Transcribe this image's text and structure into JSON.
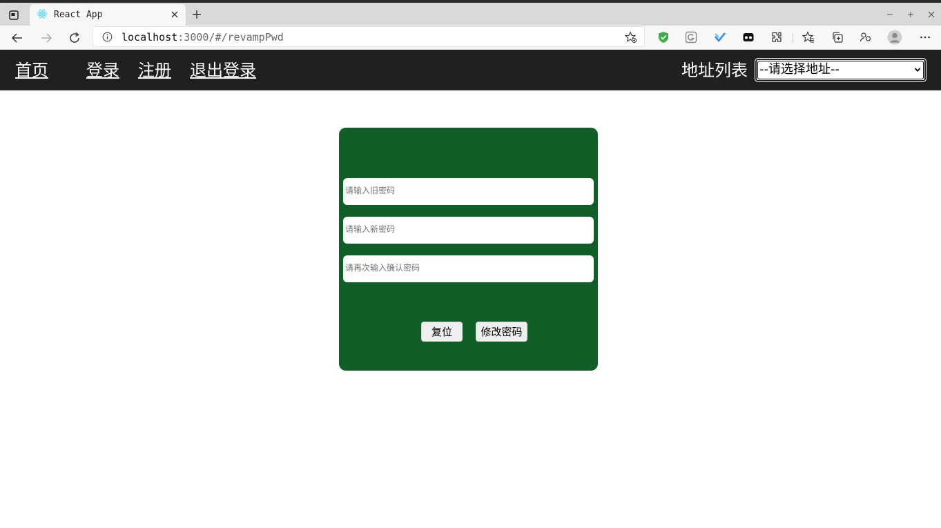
{
  "browser": {
    "tab_title": "React App",
    "url_host": "localhost",
    "url_rest": ":3000/#/revampPwd"
  },
  "header": {
    "home": "首页",
    "login": "登录",
    "register": "注册",
    "logout": "退出登录",
    "address_label": "地址列表",
    "address_select_value": "--请选择地址--"
  },
  "form": {
    "old_password_placeholder": "请输入旧密码",
    "new_password_placeholder": "请输入新密码",
    "confirm_password_placeholder": "请再次输入确认密码",
    "reset_label": "复位",
    "submit_label": "修改密码"
  },
  "colors": {
    "header_bg": "#21201e",
    "card_bg": "#115e29"
  }
}
